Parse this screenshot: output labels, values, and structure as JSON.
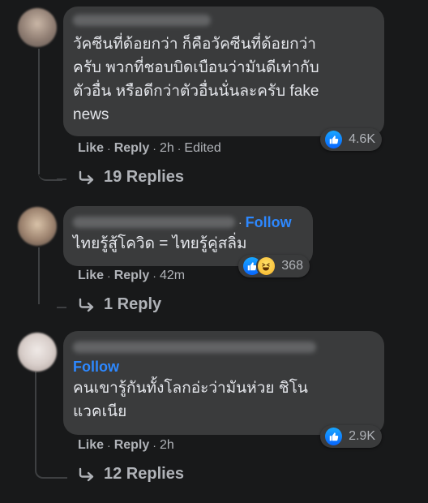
{
  "comments": [
    {
      "text": "วัคซีนที่ด้อยกว่า ก็คือวัคซีนที่ด้อยกว่า\nครับ พวกที่ชอบบิดเบือนว่ามันดีเท่ากับ\nตัวอื่น หรือดีกว่าตัวอื่นนั่นละครับ fake\nnews",
      "reaction_count": "4.6K",
      "like_label": "Like",
      "reply_label": "Reply",
      "time": "2h",
      "edited": "Edited",
      "replies_label": "19 Replies"
    },
    {
      "follow": "Follow",
      "text": "ไทยรู้สู้โควิด = ไทยรู้คู่สลิ่ม",
      "reaction_count": "368",
      "like_label": "Like",
      "reply_label": "Reply",
      "time": "42m",
      "replies_label": "1 Reply"
    },
    {
      "follow": "Follow",
      "text": "คนเขารู้กันทั้งโลกอ่ะว่ามันห่วย ชิโน\nแวคเนีย",
      "reaction_count": "2.9K",
      "like_label": "Like",
      "reply_label": "Reply",
      "time": "2h",
      "replies_label": "12 Replies"
    }
  ],
  "colors": {
    "background": "#18191a",
    "bubble": "#3a3b3c",
    "link": "#2d88ff",
    "secondary_text": "#b0b3b8"
  }
}
